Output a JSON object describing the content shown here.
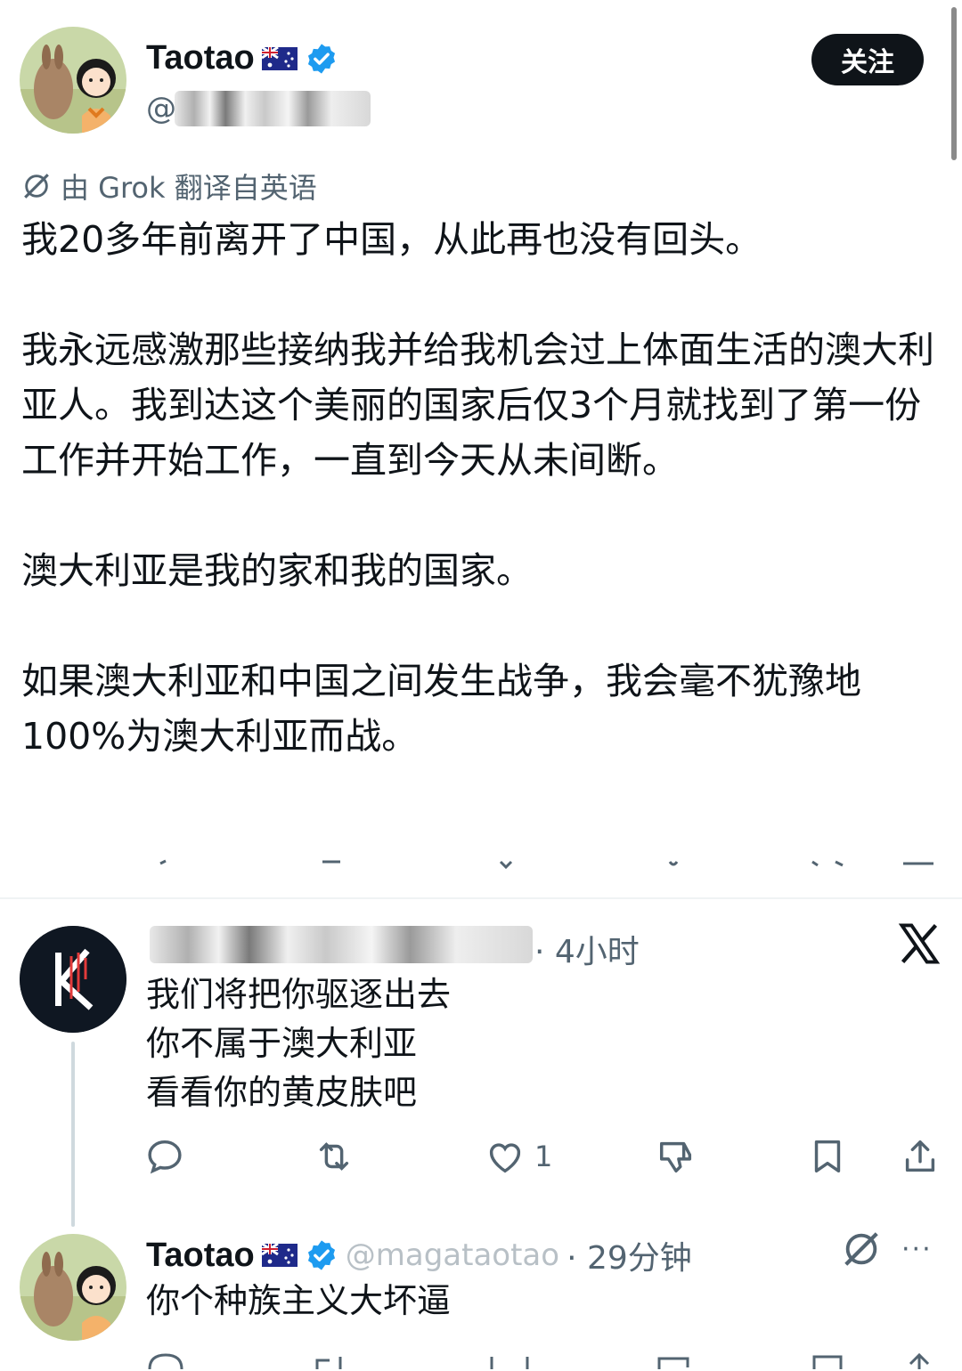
{
  "post": {
    "author_name": "Taotao",
    "handle_partial": "@",
    "follow_label": "关注",
    "translation_note": "由 Grok 翻译自英语",
    "paragraphs": [
      "我20多年前离开了中国，从此再也没有回头。",
      "我永远感激那些接纳我并给我机会过上体面生活的澳大利亚人。我到达这个美丽的国家后仅3个月就找到了第一份工作并开始工作，一直到今天从未间断。",
      "澳大利亚是我的家和我的国家。",
      "如果澳大利亚和中国之间发生战争，我会毫不犹豫地100%为澳大利亚而战。"
    ]
  },
  "reply1": {
    "time": "· 4小时",
    "lines": [
      "我们将把你驱逐出去",
      "你不属于澳大利亚",
      "看看你的黄皮肤吧"
    ],
    "like_count": "1"
  },
  "reply2": {
    "author_name": "Taotao",
    "handle": "@magataotao",
    "time": "· 29分钟",
    "text": "你个种族主义大坏逼"
  },
  "more_label": "···",
  "icons": [
    "grok-icon",
    "verified-badge-icon",
    "australia-flag-icon",
    "x-logo-icon",
    "reply-icon",
    "repost-icon",
    "like-icon",
    "dislike-icon",
    "bookmark-icon",
    "share-icon",
    "more-icon"
  ],
  "colors": {
    "text": "#0f1419",
    "secondary": "#536471",
    "verified": "#1d9bf0",
    "button": "#0f1419"
  }
}
